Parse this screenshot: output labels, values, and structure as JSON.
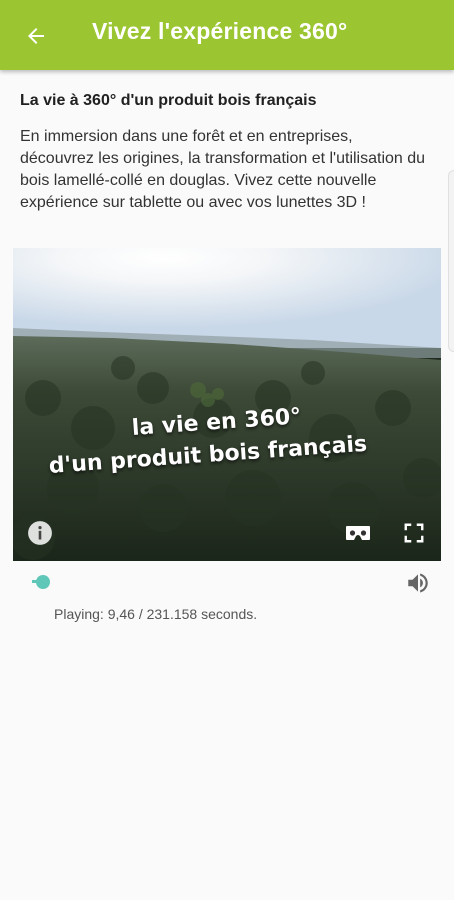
{
  "appbar": {
    "title": "Vivez l'expérience 360°",
    "back_icon": "arrow-left-icon",
    "color": "#9bc631"
  },
  "content": {
    "title": "La vie à 360° d'un produit bois français",
    "description": "En immersion dans une forêt et en entreprises, découvrez les origines, la transformation et l'utilisation du bois lamellé-collé en douglas. Vivez cette nouvelle expérience sur tablette ou avec vos lunettes 3D !"
  },
  "video": {
    "overlay_line1": "la vie en 360°",
    "overlay_line2": "d'un produit bois français",
    "controls": {
      "info_icon": "info-icon",
      "vr_icon": "cardboard-vr-icon",
      "fullscreen_icon": "fullscreen-icon"
    }
  },
  "player": {
    "progress_fraction": 0.04,
    "volume_icon": "volume-icon",
    "accent": "#5fc7b8",
    "status": "Playing: 9,46 / 231.158 seconds."
  }
}
